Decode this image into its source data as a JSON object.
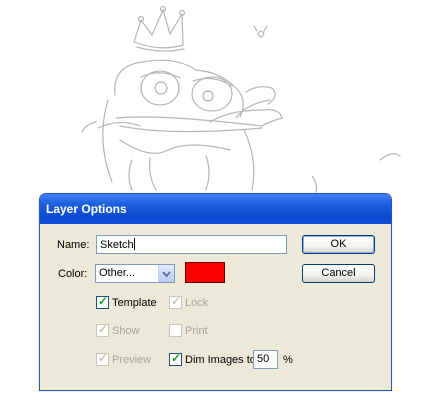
{
  "dialog": {
    "title": "Layer Options",
    "name_label": "Name:",
    "name_value": "Sketch",
    "color_label": "Color:",
    "color_select_value": "Other...",
    "color_swatch": "#ff0000",
    "ok_label": "OK",
    "cancel_label": "Cancel",
    "options": {
      "template": {
        "label": "Template",
        "checked": true,
        "enabled": true
      },
      "lock": {
        "label": "Lock",
        "checked": true,
        "enabled": false
      },
      "show": {
        "label": "Show",
        "checked": true,
        "enabled": false
      },
      "print": {
        "label": "Print",
        "checked": false,
        "enabled": false
      },
      "preview": {
        "label": "Preview",
        "checked": true,
        "enabled": false
      },
      "dim_images": {
        "label": "Dim Images to:",
        "checked": true,
        "enabled": true
      }
    },
    "dim_value": "50",
    "dim_unit": "%"
  },
  "colors": {
    "title_bar": "#0a47cf",
    "dialog_bg": "#ece9d8",
    "swatch": "#ff0000"
  },
  "icons": {
    "dropdown": "chevron-down-icon",
    "checkbox": "checkmark-icon"
  }
}
